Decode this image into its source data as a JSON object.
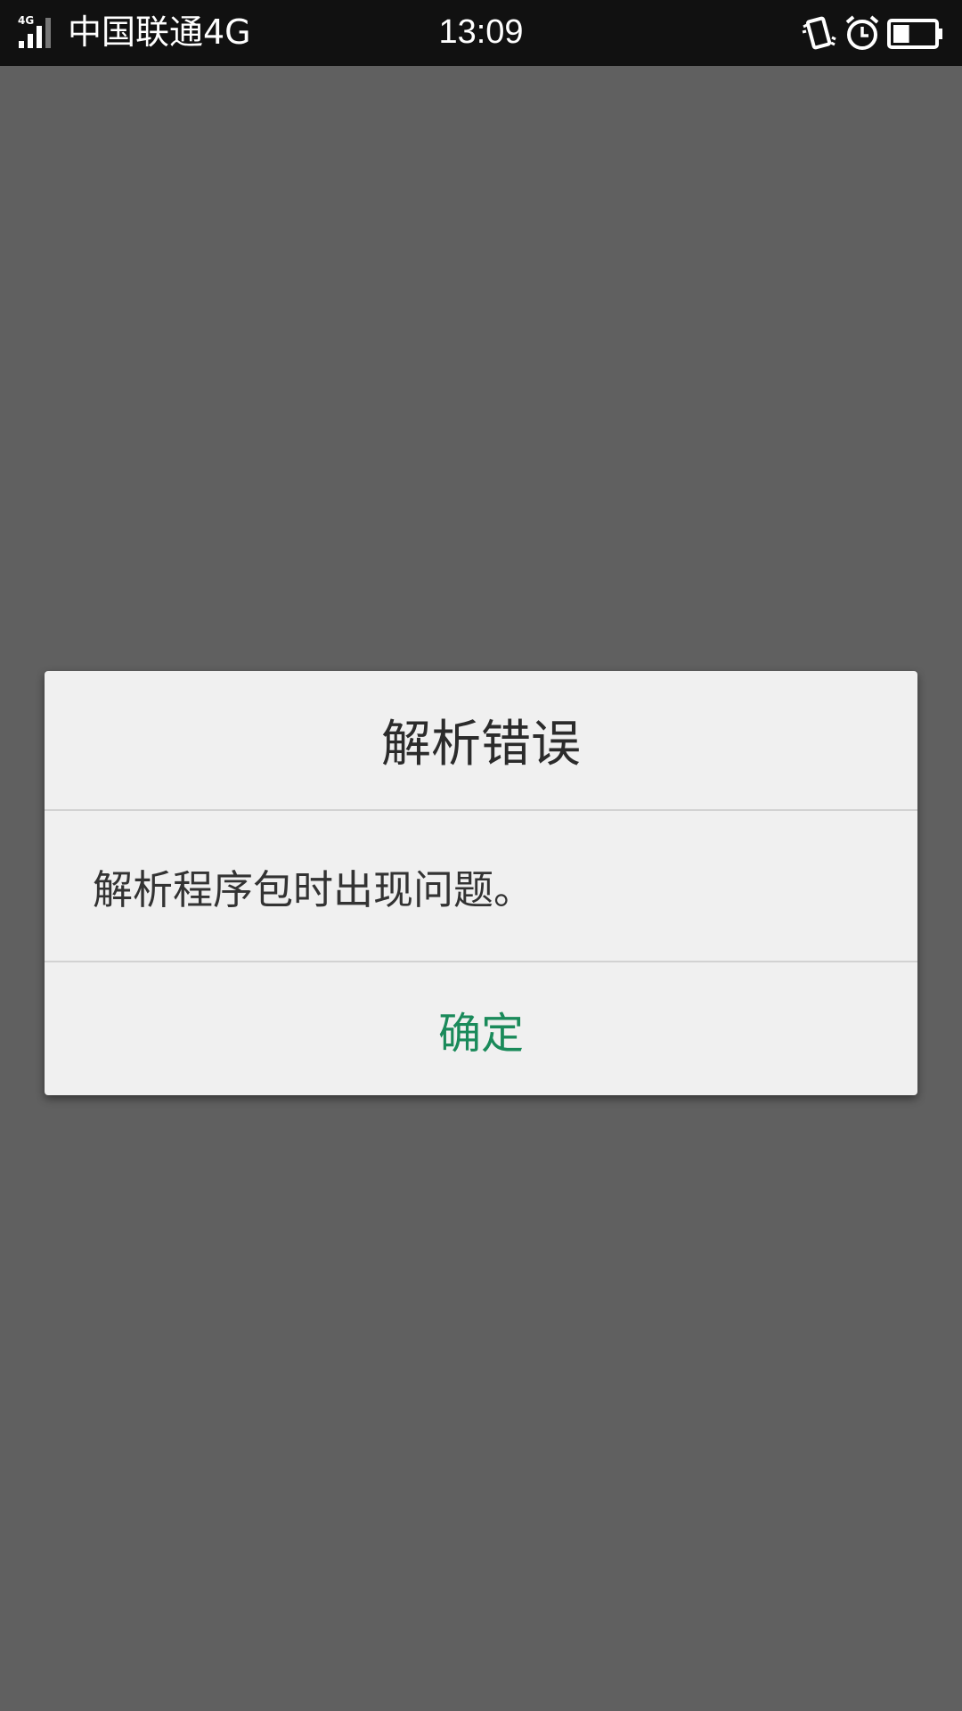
{
  "status_bar": {
    "network_badge": "4G",
    "carrier": "中国联通4G",
    "time": "13:09",
    "icons": [
      "signal-icon",
      "vibrate-icon",
      "alarm-icon",
      "battery-icon"
    ],
    "battery_level": 0.4
  },
  "dialog": {
    "title": "解析错误",
    "message": "解析程序包时出现问题。",
    "ok_label": "确定",
    "accent_color": "#1a8a5a"
  },
  "colors": {
    "status_bar_bg": "#111111",
    "overlay_bg": "#606060",
    "dialog_bg": "#f0f0f0"
  }
}
